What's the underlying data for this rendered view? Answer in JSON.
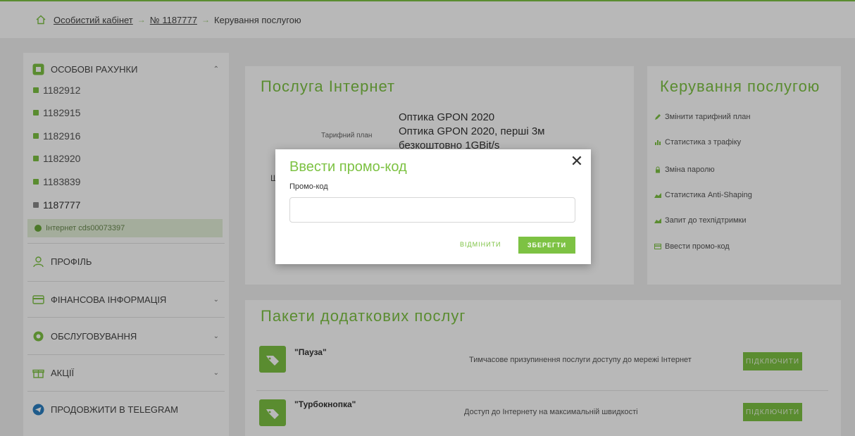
{
  "breadcrumb": {
    "items": [
      "Особистий кабінет",
      "№ 1187777",
      "Керування послугою"
    ],
    "separator": "→"
  },
  "sidebar": {
    "accounts_header": "ОСОБОВІ РАХУНКИ",
    "accounts": [
      "1182912",
      "1182915",
      "1182916",
      "1182920",
      "1183839",
      "1187777"
    ],
    "internet_item": "Інтернет cds00073397",
    "profile": "ПРОФІЛЬ",
    "finance": "ФІНАНСОВА ІНФОРМАЦІЯ",
    "service": "ОБСЛУГОВУВАННЯ",
    "promo": "АКЦІЇ",
    "telegram": "ПРОДОВЖИТИ В TELEGRAM"
  },
  "service_card": {
    "title": "Послуга Інтернет",
    "plan_label": "Тарифний план",
    "plan_value_line1": "Оптика GPON 2020",
    "plan_value_line2": "Оптика GPON 2020, перші 3м",
    "plan_value_line3": "безкоштовно 1GBit/s",
    "partial_label": "Щ"
  },
  "management": {
    "title": "Керування послугою",
    "items": [
      "Змінити тарифний план",
      "Статистика з трафіку",
      "Зміна паролю",
      "Статистика Anti-Shaping",
      "Запит до техпідтримки",
      "Ввести промо-код"
    ]
  },
  "packages": {
    "title": "Пакети додаткових послуг",
    "rows": [
      {
        "name": "\"Пауза\"",
        "desc": "Тимчасове призупинення послуги доступу до мережі Інтернет",
        "button": "ПІДКЛЮЧИТИ"
      },
      {
        "name": "\"Турбокнопка\"",
        "desc": "Доступ до Інтернету на максимальній швидкості",
        "button": "ПІДКЛЮЧИТИ"
      }
    ]
  },
  "modal": {
    "title": "Ввести промо-код",
    "close_glyph": "✕",
    "label": "Промо-код",
    "input_value": "",
    "input_placeholder": "",
    "cancel": "ВІДМІНИТИ",
    "save": "ЗБЕРЕГТИ"
  },
  "colors": {
    "accent": "#7dc243",
    "overlay": "rgba(0,0,0,0.28)",
    "telegram": "#2a7fc1"
  }
}
